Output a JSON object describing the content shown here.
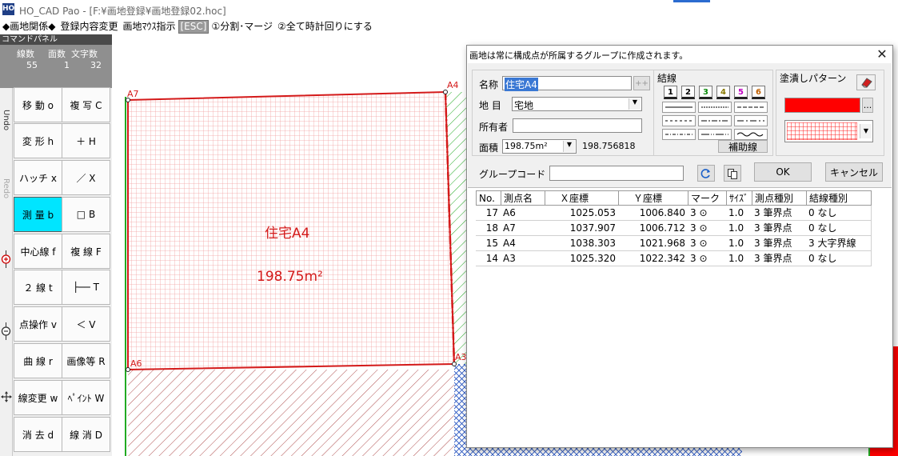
{
  "window": {
    "app_icon": "HO",
    "title": "HO_CAD Pao - [F:¥画地登録¥画地登録02.hoc]"
  },
  "menubar": {
    "items": [
      "◆画地関係◆",
      "登録内容変更",
      "画地ﾏｳｽ指示",
      "[ESC]",
      "①分割･マージ",
      "②全て時計回りにする"
    ]
  },
  "command_panel": {
    "header": "コマンドパネル",
    "stats": {
      "lines_label": "線数",
      "faces_label": "面数",
      "chars_label": "文字数",
      "lines": "55",
      "faces": "1",
      "chars": "32"
    },
    "side": {
      "undo": "Undo",
      "redo": "Redo"
    },
    "buttons": [
      [
        "移 動 o",
        "複 写 C"
      ],
      [
        "変 形 h",
        "＋ H"
      ],
      [
        "ハッチ x",
        "／ X"
      ],
      [
        "測 量 b",
        "□ B"
      ],
      [
        "中心線 f",
        "複 線 F"
      ],
      [
        "２ 線 t",
        "├── T"
      ],
      [
        "点操作 v",
        "＜ V"
      ],
      [
        "曲 線 r",
        "画像等 R"
      ],
      [
        "線変更 w",
        "ﾍﾟｲﾝﾄ W"
      ],
      [
        "消 去 d",
        "線 消 D"
      ]
    ],
    "active_button": "測 量 b"
  },
  "canvas": {
    "points": {
      "a7": "A7",
      "a4": "A4",
      "a6": "A6",
      "a3": "A3"
    },
    "parcel_name": "住宅A4",
    "parcel_area": "198.75m²",
    "colors": {
      "boundary": "#d41a1a",
      "grid": "#f2a3a3",
      "hatch": "#b05050",
      "blue_hatch": "#2050c0",
      "green": "#22aa22"
    }
  },
  "dialog": {
    "title": "画地は常に構成点が所属するグループに作成されます。",
    "name_label": "名称",
    "name_value": "住宅A4",
    "name_btn": "++",
    "chimoku_label": "地 目",
    "chimoku_value": "宅地",
    "owner_label": "所有者",
    "owner_value": "",
    "area_label": "面積",
    "area_value": "198.75m²",
    "area_exact": "198.756818",
    "line_section_label": "結線",
    "line_numbers": [
      "1",
      "2",
      "3",
      "4",
      "5",
      "6"
    ],
    "line_number_colors": [
      "#000000",
      "#000000",
      "#0a8a0a",
      "#8a7a00",
      "#c000c0",
      "#c06000"
    ],
    "aux_line_btn": "補助線",
    "fill_label": "塗潰しパターン",
    "fill_color": "#ff0000",
    "fill_more_btn": "...",
    "group_code_label": "グループコード",
    "group_code_value": "",
    "ok_btn": "OK",
    "cancel_btn": "キャンセル",
    "table": {
      "headers": [
        "No.",
        "測点名",
        "Ｘ座標",
        "Ｙ座標",
        "マーク",
        "ｻｲｽﾞ",
        "測点種別",
        "結線種別"
      ],
      "rows": [
        [
          "17",
          "A6",
          "1025.053",
          "1006.840",
          "3 ⊙",
          "1.0",
          "3 筆界点",
          "0 なし"
        ],
        [
          "18",
          "A7",
          "1037.907",
          "1006.712",
          "3 ⊙",
          "1.0",
          "3 筆界点",
          "0 なし"
        ],
        [
          "15",
          "A4",
          "1038.303",
          "1021.968",
          "3 ⊙",
          "1.0",
          "3 筆界点",
          "3 大字界線"
        ],
        [
          "14",
          "A3",
          "1025.320",
          "1022.342",
          "3 ⊙",
          "1.0",
          "3 筆界点",
          "0 なし"
        ]
      ]
    }
  }
}
